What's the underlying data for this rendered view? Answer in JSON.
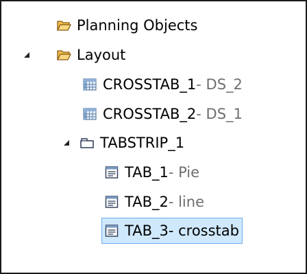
{
  "tree": {
    "planning_objects": {
      "label": "Planning Objects",
      "icon": "folder-open-icon"
    },
    "layout": {
      "label": "Layout",
      "icon": "folder-open-icon",
      "expanded": true
    },
    "crosstab_1": {
      "label": "CROSSTAB_1",
      "suffix": " - DS_2",
      "icon": "crosstab-icon"
    },
    "crosstab_2": {
      "label": "CROSSTAB_2",
      "suffix": " - DS_1",
      "icon": "crosstab-icon"
    },
    "tabstrip_1": {
      "label": "TABSTRIP_1",
      "icon": "tabstrip-icon",
      "expanded": true
    },
    "tab_1": {
      "label": "TAB_1",
      "suffix": " - Pie",
      "icon": "tab-page-icon"
    },
    "tab_2": {
      "label": "TAB_2",
      "suffix": " - line",
      "icon": "tab-page-icon"
    },
    "tab_3": {
      "label": "TAB_3",
      "suffix": " - crosstab",
      "icon": "tab-page-icon",
      "selected": true
    }
  },
  "colors": {
    "folder": "#f0c050",
    "folder_outline": "#8a5a12",
    "selection_bg": "#cfe8fc",
    "selection_border": "#6aaef0",
    "suffix_text": "#6e6e6e"
  }
}
